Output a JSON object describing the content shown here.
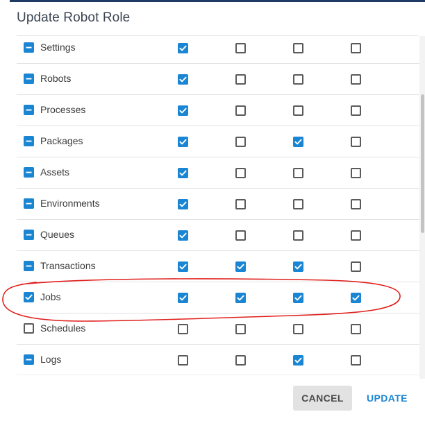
{
  "dialog": {
    "title": "Update Robot Role"
  },
  "colors": {
    "accent": "#1a86d3",
    "annotation": "#e0201c"
  },
  "rows": [
    {
      "label": "Settings",
      "state": "mixed",
      "permissions": [
        true,
        false,
        false,
        false
      ]
    },
    {
      "label": "Robots",
      "state": "mixed",
      "permissions": [
        true,
        false,
        false,
        false
      ]
    },
    {
      "label": "Processes",
      "state": "mixed",
      "permissions": [
        true,
        false,
        false,
        false
      ]
    },
    {
      "label": "Packages",
      "state": "mixed",
      "permissions": [
        true,
        false,
        true,
        false
      ]
    },
    {
      "label": "Assets",
      "state": "mixed",
      "permissions": [
        true,
        false,
        false,
        false
      ]
    },
    {
      "label": "Environments",
      "state": "mixed",
      "permissions": [
        true,
        false,
        false,
        false
      ]
    },
    {
      "label": "Queues",
      "state": "mixed",
      "permissions": [
        true,
        false,
        false,
        false
      ]
    },
    {
      "label": "Transactions",
      "state": "mixed",
      "permissions": [
        true,
        true,
        true,
        false
      ]
    },
    {
      "label": "Jobs",
      "state": "checked",
      "permissions": [
        true,
        true,
        true,
        true
      ]
    },
    {
      "label": "Schedules",
      "state": "unchecked",
      "permissions": [
        false,
        false,
        false,
        false
      ]
    },
    {
      "label": "Logs",
      "state": "mixed",
      "permissions": [
        false,
        false,
        true,
        false
      ]
    }
  ],
  "buttons": {
    "cancel": "CANCEL",
    "update": "UPDATE"
  }
}
